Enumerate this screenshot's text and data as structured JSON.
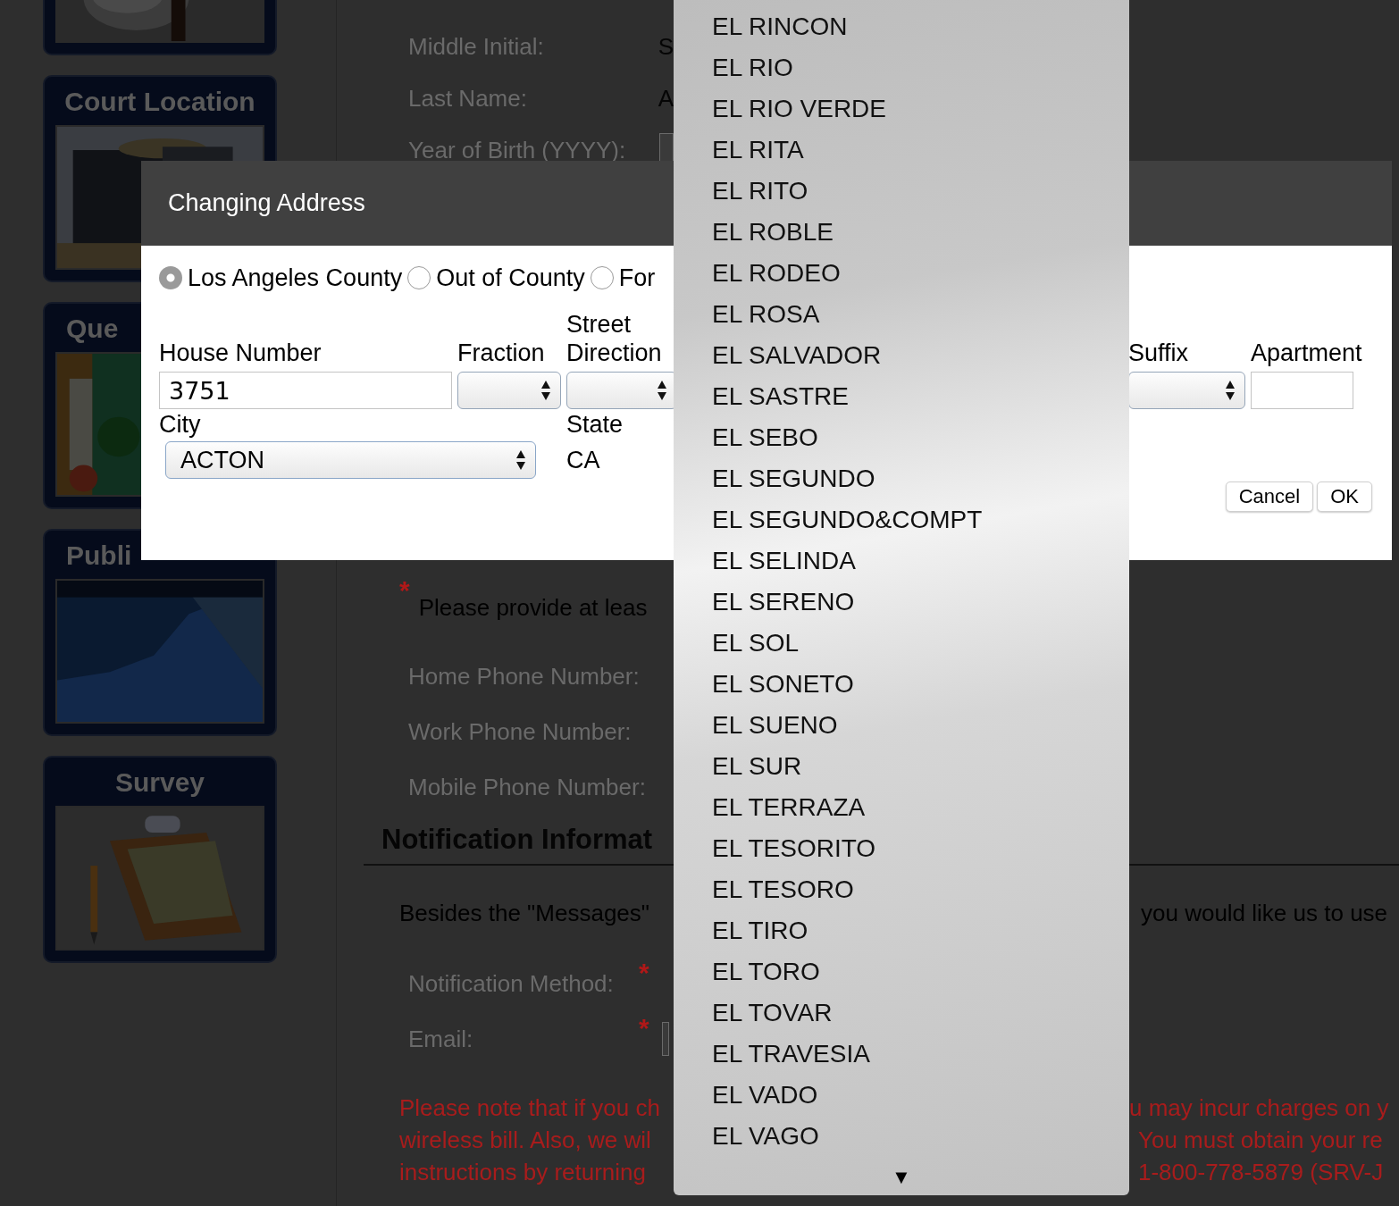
{
  "sidebar": {
    "cards": [
      {
        "kind": "untitled"
      },
      {
        "kind": "titled",
        "title": "Court Location"
      },
      {
        "kind": "titled",
        "title": "Que",
        "partial": true
      },
      {
        "kind": "titled",
        "title": "Publi",
        "partial": true
      },
      {
        "kind": "titled",
        "title": "Survey"
      }
    ]
  },
  "form": {
    "fields": [
      {
        "label": "Middle Initial:",
        "value": "S"
      },
      {
        "label": "Last Name:",
        "value": "A"
      },
      {
        "label": "Year of Birth (YYYY):",
        "kind": "input"
      }
    ],
    "contact_prompt": {
      "mark": "*",
      "text": "Please provide at leas"
    },
    "phone_fields": [
      "Home Phone Number:",
      "Work Phone Number:",
      "Mobile Phone Number:"
    ],
    "notification": {
      "heading": "Notification Informat",
      "intro_left": "Besides the \"Messages\"",
      "intro_right": "you would like us to use",
      "fields": [
        {
          "label": "Notification Method:",
          "mark": "*"
        },
        {
          "label": "Email:",
          "mark": "*",
          "kind": "input"
        }
      ],
      "notice_lines": [
        {
          "left": "Please note that if you ch",
          "right": "u may incur charges on y"
        },
        {
          "left": "wireless bill. Also, we wil",
          "right": "You must obtain your re"
        },
        {
          "left": "instructions by returning",
          "right": "1-800-778-5879 (SRV-J"
        }
      ]
    }
  },
  "dialog": {
    "title": "Changing Address",
    "location_options": [
      {
        "label": "Los Angeles County",
        "selected": true
      },
      {
        "label": "Out of County",
        "selected": false
      },
      {
        "label": "For",
        "selected": false
      }
    ],
    "columns": [
      {
        "label": "House Number",
        "kind": "input",
        "value": "3751"
      },
      {
        "label": "Fraction",
        "kind": "select"
      },
      {
        "label": "Street Direction",
        "kind": "select"
      },
      {
        "label": "Suffix",
        "kind": "select"
      },
      {
        "label": "Apartment",
        "kind": "input"
      }
    ],
    "city": {
      "label": "City",
      "value": "ACTON"
    },
    "state": {
      "label": "State",
      "value": "CA"
    },
    "buttons": [
      "Cancel",
      "OK"
    ]
  },
  "dropdown": {
    "options": [
      "EL RINCON",
      "EL RIO",
      "EL RIO VERDE",
      "EL RITA",
      "EL RITO",
      "EL ROBLE",
      "EL RODEO",
      "EL ROSA",
      "EL SALVADOR",
      "EL SASTRE",
      "EL SEBO",
      "EL SEGUNDO",
      "EL SEGUNDO&COMPT",
      "EL SELINDA",
      "EL SERENO",
      "EL SOL",
      "EL SONETO",
      "EL SUENO",
      "EL SUR",
      "EL TERRAZA",
      "EL TESORITO",
      "EL TESORO",
      "EL TIRO",
      "EL TORO",
      "EL TOVAR",
      "EL TRAVESIA",
      "EL VADO",
      "EL VAGO"
    ],
    "more_indicator": "▼"
  }
}
